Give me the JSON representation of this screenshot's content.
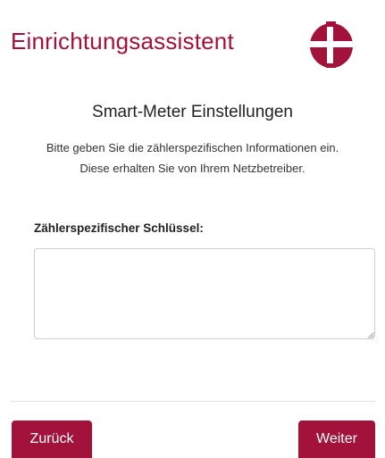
{
  "header": {
    "title": "Einrichtungsassistent",
    "logo_icon": "brand-logo-icon",
    "brand_color": "#a3123a"
  },
  "section": {
    "title": "Smart-Meter Einstellungen",
    "intro_line1": "Bitte geben Sie die zählerspezifischen Informationen ein.",
    "intro_line2": "Diese erhalten Sie von Ihrem Netzbetreiber."
  },
  "form": {
    "key_label": "Zählerspezifischer Schlüssel:",
    "key_value": ""
  },
  "footer": {
    "back_label": "Zurück",
    "next_label": "Weiter"
  }
}
